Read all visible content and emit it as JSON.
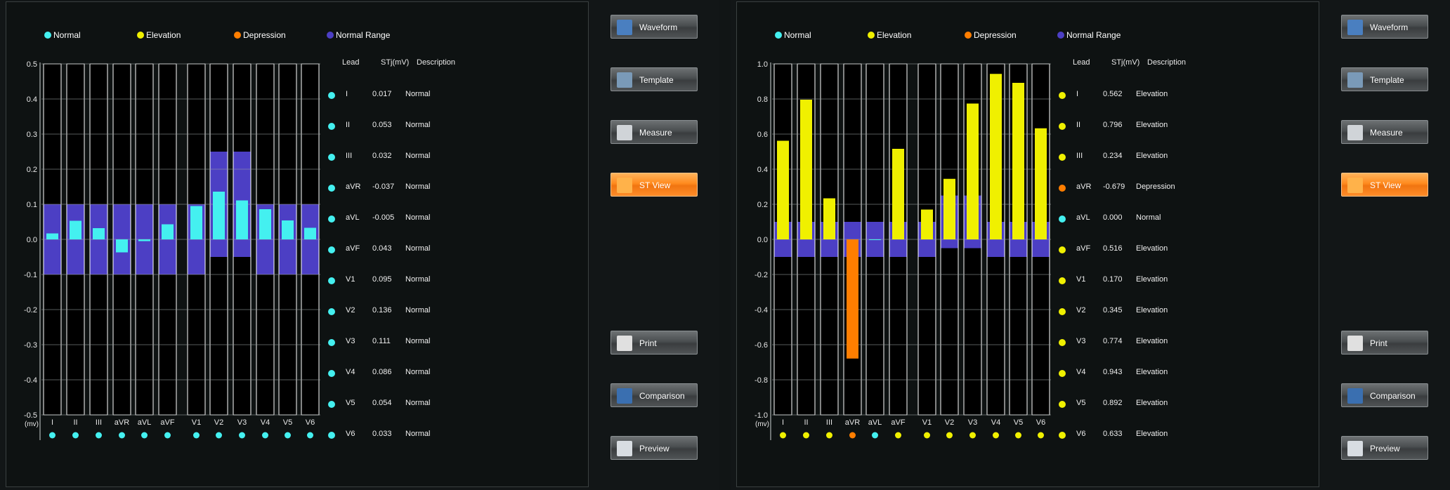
{
  "legend": [
    {
      "label": "Normal",
      "color": "#44f0f0"
    },
    {
      "label": "Elevation",
      "color": "#f0f000"
    },
    {
      "label": "Depression",
      "color": "#ff7e00"
    },
    {
      "label": "Normal Range",
      "color": "#4c3fc4"
    }
  ],
  "table_headers": {
    "lead": "Lead",
    "stj": "STj(mV)",
    "desc": "Description"
  },
  "buttons": [
    {
      "label": "Waveform",
      "icon": "waveform-icon",
      "active": false
    },
    {
      "label": "Template",
      "icon": "template-icon",
      "active": false
    },
    {
      "label": "Measure",
      "icon": "measure-icon",
      "active": false
    },
    {
      "label": "ST View",
      "icon": "st-view-icon",
      "active": true
    },
    {
      "label": "Print",
      "icon": "printer-icon",
      "active": false
    },
    {
      "label": "Comparison",
      "icon": "comparison-icon",
      "active": false
    },
    {
      "label": "Preview",
      "icon": "preview-icon",
      "active": false
    }
  ],
  "colors": {
    "normal": "#44f0f0",
    "elevation": "#f0f000",
    "depression": "#ff7e00",
    "range": "#4c3fc4"
  },
  "chart_data": [
    {
      "type": "bar",
      "ylabel": "(mv)",
      "ylim": [
        -0.5,
        0.5
      ],
      "yticks": [
        "0.5",
        "0.4",
        "0.3",
        "0.2",
        "0.1",
        "0.0",
        "-0.1",
        "-0.2",
        "-0.3",
        "-0.4",
        "-0.5"
      ],
      "categories": [
        "I",
        "II",
        "III",
        "aVR",
        "aVL",
        "aVF",
        "V1",
        "V2",
        "V3",
        "V4",
        "V5",
        "V6"
      ],
      "values": [
        0.017,
        0.053,
        0.032,
        -0.037,
        -0.005,
        0.043,
        0.095,
        0.136,
        0.111,
        0.086,
        0.054,
        0.033
      ],
      "values_text": [
        "0.017",
        "0.053",
        "0.032",
        "-0.037",
        "-0.005",
        "0.043",
        "0.095",
        "0.136",
        "0.111",
        "0.086",
        "0.054",
        "0.033"
      ],
      "status": [
        "normal",
        "normal",
        "normal",
        "normal",
        "normal",
        "normal",
        "normal",
        "normal",
        "normal",
        "normal",
        "normal",
        "normal"
      ],
      "descriptions": [
        "Normal",
        "Normal",
        "Normal",
        "Normal",
        "Normal",
        "Normal",
        "Normal",
        "Normal",
        "Normal",
        "Normal",
        "Normal",
        "Normal"
      ],
      "normal_range": [
        [
          -0.1,
          0.1
        ],
        [
          -0.1,
          0.1
        ],
        [
          -0.1,
          0.1
        ],
        [
          -0.1,
          0.1
        ],
        [
          -0.1,
          0.1
        ],
        [
          -0.1,
          0.1
        ],
        [
          -0.1,
          0.1
        ],
        [
          -0.05,
          0.25
        ],
        [
          -0.05,
          0.25
        ],
        [
          -0.1,
          0.1
        ],
        [
          -0.1,
          0.1
        ],
        [
          -0.1,
          0.1
        ]
      ],
      "grid": true
    },
    {
      "type": "bar",
      "ylabel": "(mv)",
      "ylim": [
        -1.0,
        1.0
      ],
      "yticks": [
        "1.0",
        "0.8",
        "0.6",
        "0.4",
        "0.2",
        "0.0",
        "-0.2",
        "-0.4",
        "-0.6",
        "-0.8",
        "-1.0"
      ],
      "categories": [
        "I",
        "II",
        "III",
        "aVR",
        "aVL",
        "aVF",
        "V1",
        "V2",
        "V3",
        "V4",
        "V5",
        "V6"
      ],
      "values": [
        0.562,
        0.796,
        0.234,
        -0.679,
        0.0,
        0.516,
        0.17,
        0.345,
        0.774,
        0.943,
        0.892,
        0.633
      ],
      "values_text": [
        "0.562",
        "0.796",
        "0.234",
        "-0.679",
        "0.000",
        "0.516",
        "0.170",
        "0.345",
        "0.774",
        "0.943",
        "0.892",
        "0.633"
      ],
      "status": [
        "elevation",
        "elevation",
        "elevation",
        "depression",
        "normal",
        "elevation",
        "elevation",
        "elevation",
        "elevation",
        "elevation",
        "elevation",
        "elevation"
      ],
      "descriptions": [
        "Elevation",
        "Elevation",
        "Elevation",
        "Depression",
        "Normal",
        "Elevation",
        "Elevation",
        "Elevation",
        "Elevation",
        "Elevation",
        "Elevation",
        "Elevation"
      ],
      "normal_range": [
        [
          -0.1,
          0.1
        ],
        [
          -0.1,
          0.1
        ],
        [
          -0.1,
          0.1
        ],
        [
          -0.1,
          0.1
        ],
        [
          -0.1,
          0.1
        ],
        [
          -0.1,
          0.1
        ],
        [
          -0.1,
          0.1
        ],
        [
          -0.05,
          0.25
        ],
        [
          -0.05,
          0.25
        ],
        [
          -0.1,
          0.1
        ],
        [
          -0.1,
          0.1
        ],
        [
          -0.1,
          0.1
        ]
      ],
      "grid": true
    }
  ]
}
